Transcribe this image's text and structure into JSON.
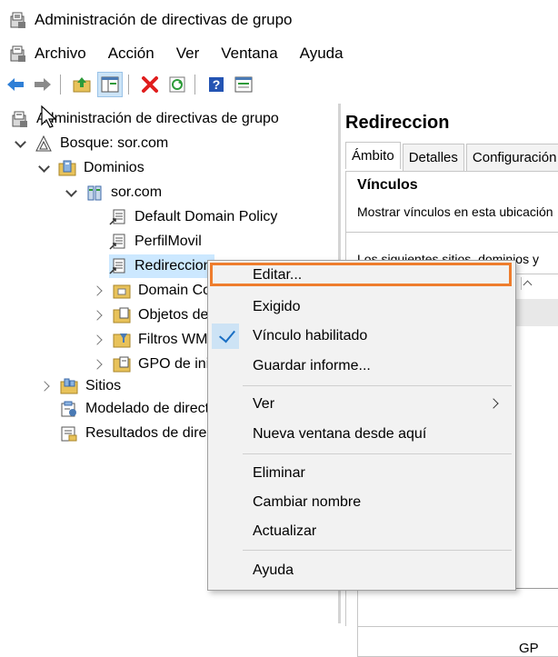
{
  "window": {
    "title": "Administración de directivas de grupo"
  },
  "menu": [
    "Archivo",
    "Acción",
    "Ver",
    "Ventana",
    "Ayuda"
  ],
  "toolbar": {
    "icons": [
      "back-arrow-icon",
      "forward-arrow-icon",
      "folder-up-icon",
      "show-hide-tree-icon",
      "delete-icon",
      "refresh-icon",
      "help-icon",
      "properties-icon"
    ],
    "help_glyph": "?"
  },
  "tree": {
    "root": "Administración de directivas de grupo",
    "forest": "Bosque: sor.com",
    "domains": "Dominios",
    "domain": "sor.com",
    "items": [
      "Default Domain Policy",
      "PerfilMovil",
      "Redireccion",
      "Domain Controllers",
      "Objetos de directiva de grupo",
      "Filtros WMI",
      "GPO de inicio"
    ],
    "sites": "Sitios",
    "modeling": "Modelado de directivas de grupo",
    "results": "Resultados de directivas de grupo"
  },
  "right_pane": {
    "title": "Redireccion",
    "tabs": [
      "Ámbito",
      "Detalles",
      "Configuración"
    ],
    "section_title": "Vínculos",
    "line1": "Mostrar vínculos en esta ubicación",
    "line2": "Los siguientes sitios, dominios y",
    "gp_text": "GP"
  },
  "context_menu": {
    "items": [
      {
        "label": "Editar...",
        "highlighted": true
      },
      {
        "label": "Exigido"
      },
      {
        "label": "Vínculo habilitado",
        "checked": true
      },
      {
        "label": "Guardar informe..."
      },
      {
        "label": "Ver",
        "submenu": true
      },
      {
        "label": "Nueva ventana desde aquí"
      },
      {
        "label": "Eliminar"
      },
      {
        "label": "Cambiar nombre"
      },
      {
        "label": "Actualizar"
      },
      {
        "label": "Ayuda"
      }
    ]
  },
  "colors": {
    "highlight_border": "#ee7d2d",
    "check": "#1a6fc4",
    "menu_bg": "#f2f2f2"
  }
}
